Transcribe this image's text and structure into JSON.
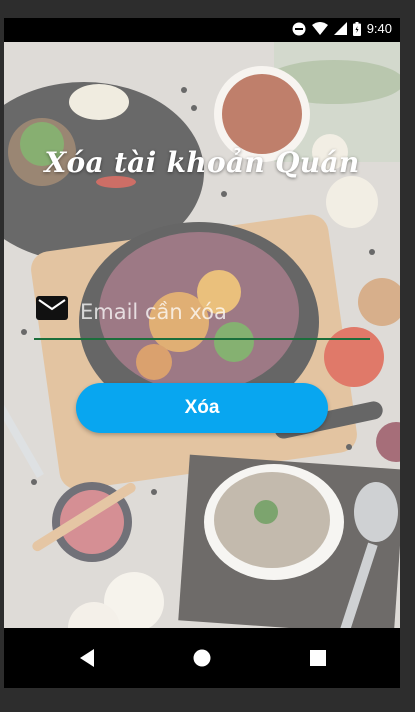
{
  "status_bar": {
    "time": "9:40",
    "icons": [
      "do-not-disturb-icon",
      "wifi-icon",
      "signal-icon",
      "battery-icon"
    ]
  },
  "screen": {
    "title": "Xóa tài khoản Quán",
    "email_placeholder": "Email cần xóa",
    "email_value": "",
    "delete_button_label": "Xóa",
    "colors": {
      "button": "#08a6f0",
      "button_text": "#ffffff",
      "underline": "#1b6e3b",
      "title": "#ffffff"
    }
  },
  "nav_bar": {
    "icons": [
      "back-icon",
      "home-icon",
      "recent-apps-icon"
    ]
  }
}
